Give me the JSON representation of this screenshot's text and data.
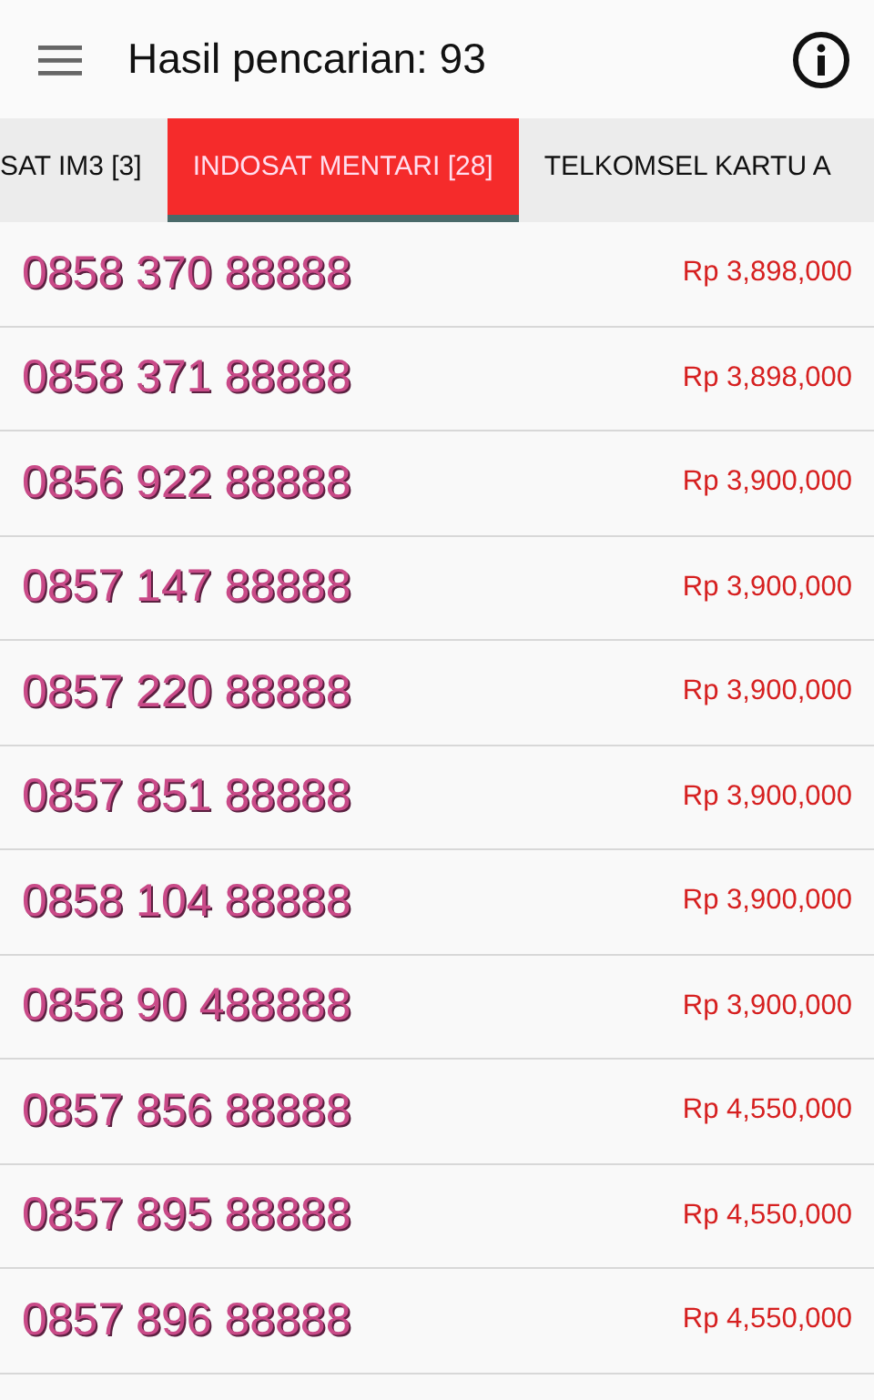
{
  "app_bar": {
    "title": "Hasil pencarian: 93"
  },
  "tabs": [
    {
      "label": "SAT IM3 [3]",
      "selected": false
    },
    {
      "label": "INDOSAT MENTARI [28]",
      "selected": true
    },
    {
      "label": "TELKOMSEL KARTU A",
      "selected": false
    }
  ],
  "results": [
    {
      "number": "0858 370 88888",
      "price": "Rp 3,898,000"
    },
    {
      "number": "0858 371 88888",
      "price": "Rp 3,898,000"
    },
    {
      "number": "0856 922 88888",
      "price": "Rp 3,900,000"
    },
    {
      "number": "0857 147 88888",
      "price": "Rp 3,900,000"
    },
    {
      "number": "0857 220 88888",
      "price": "Rp 3,900,000"
    },
    {
      "number": "0857 851 88888",
      "price": "Rp 3,900,000"
    },
    {
      "number": "0858 104 88888",
      "price": "Rp 3,900,000"
    },
    {
      "number": "0858 90 488888",
      "price": "Rp 3,900,000"
    },
    {
      "number": "0857 856 88888",
      "price": "Rp 4,550,000"
    },
    {
      "number": "0857 895 88888",
      "price": "Rp 4,550,000"
    },
    {
      "number": "0857 896 88888",
      "price": "Rp 4,550,000"
    }
  ]
}
